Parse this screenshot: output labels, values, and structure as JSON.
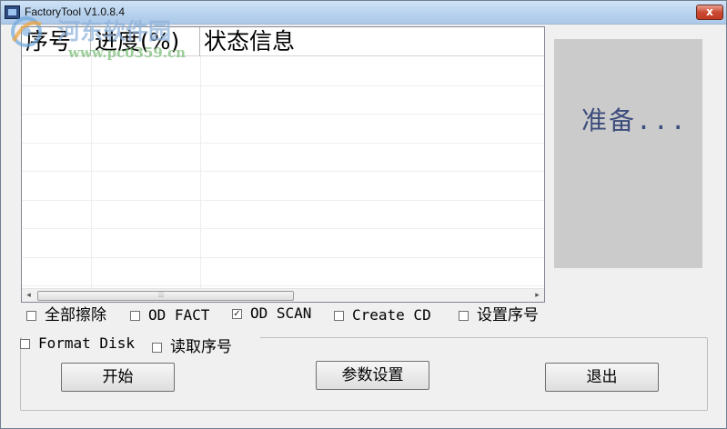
{
  "window": {
    "title": "FactoryTool V1.0.8.4",
    "close_label": "x"
  },
  "watermark": {
    "title": "河东软件园",
    "url": "www.pc0359.cn"
  },
  "list": {
    "columns": [
      "序号",
      "进度(%)",
      "状态信息"
    ],
    "rows": []
  },
  "status": {
    "text": "准备..."
  },
  "options": {
    "erase_all": {
      "label": "全部擦除",
      "checked": false
    },
    "od_fact": {
      "label": "OD FACT",
      "checked": false
    },
    "od_scan": {
      "label": "OD SCAN",
      "checked": true
    },
    "create_cd": {
      "label": "Create CD",
      "checked": false
    },
    "set_serial": {
      "label": "设置序号",
      "checked": false
    },
    "format_disk": {
      "label": "Format Disk",
      "checked": false
    },
    "read_serial": {
      "label": "读取序号",
      "checked": false
    }
  },
  "buttons": {
    "start": "开始",
    "params": "参数设置",
    "exit": "退出"
  },
  "colors": {
    "status_text": "#3c4c7c",
    "status_panel": "#cbcbcb",
    "watermark_blue": "#8fb4dc",
    "watermark_green": "#7cbf7a"
  },
  "icons": {
    "app": "factory-tool-icon",
    "close": "close-icon",
    "scroll_left": "chevron-left-icon",
    "scroll_right": "chevron-right-icon",
    "watermark_logo": "hedong-logo-icon"
  }
}
